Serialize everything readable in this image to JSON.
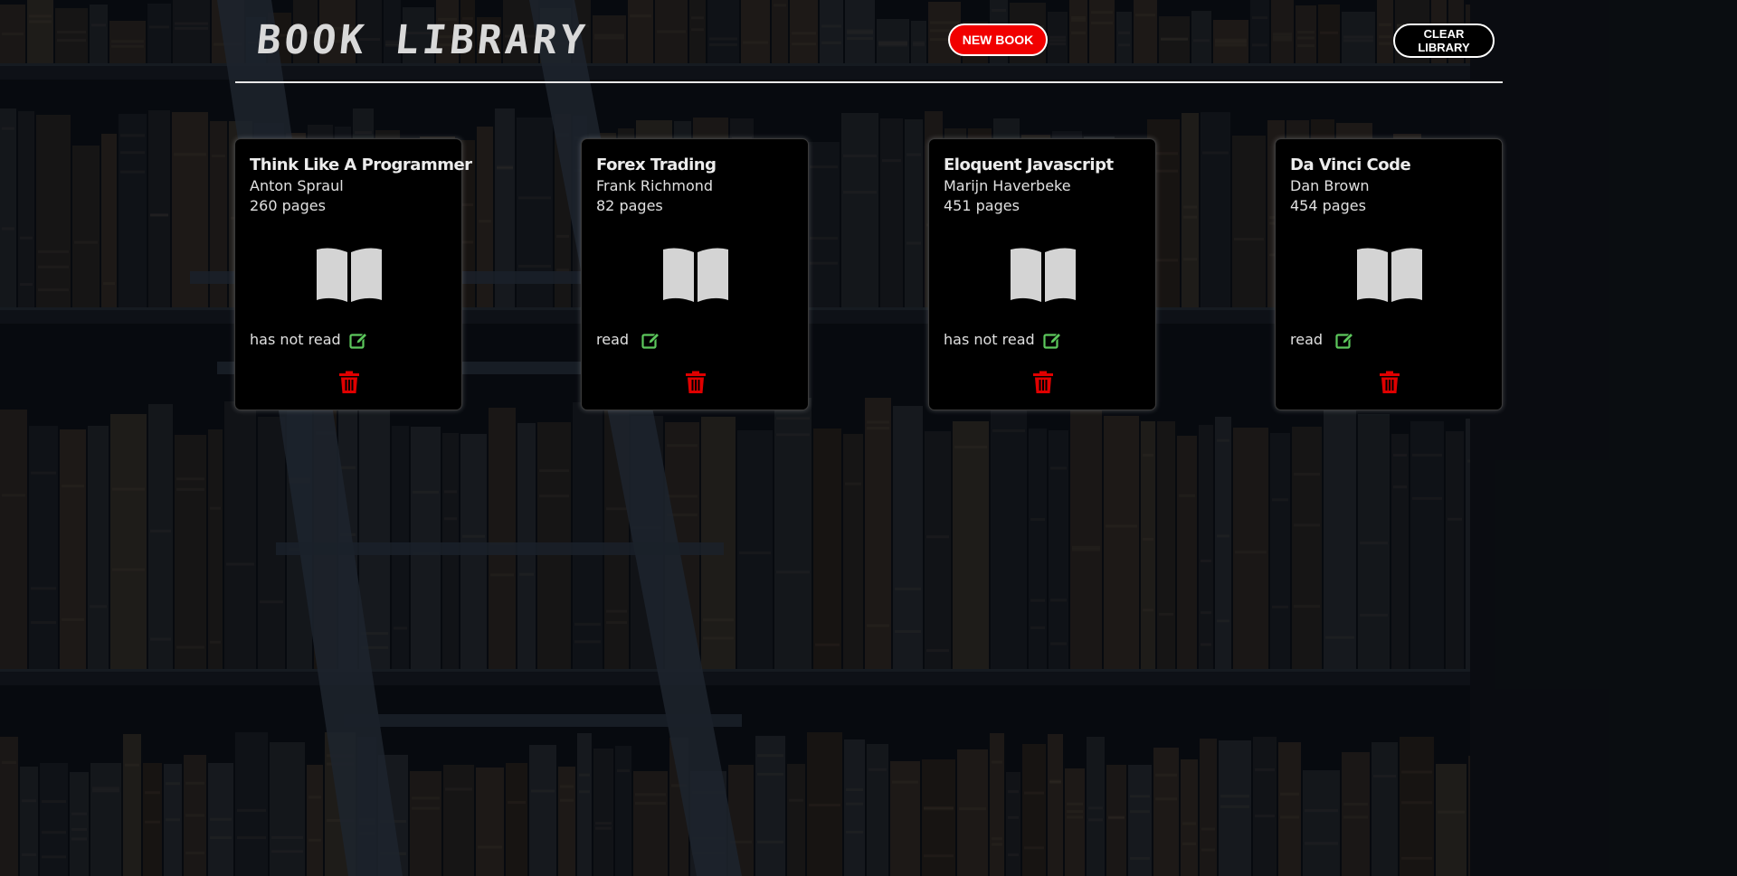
{
  "header": {
    "logo": "BOOK LIBRARY",
    "new_book_label": "NEW BOOK",
    "clear_library_label": "CLEAR\nLIBRARY"
  },
  "colors": {
    "accent_red": "#f10000",
    "edit_green": "#5cc85c",
    "card_bg": "#000000",
    "icon_gray": "#d4d4d4"
  },
  "books": [
    {
      "title": "Think Like A Programmer",
      "author": "Anton Spraul",
      "pages": "260 pages",
      "status": "has not read",
      "icon": "book-open-icon"
    },
    {
      "title": "Forex Trading",
      "author": "Frank Richmond",
      "pages": "82 pages",
      "status": "read",
      "icon": "book-open-icon"
    },
    {
      "title": "Eloquent Javascript",
      "author": "Marijn Haverbeke",
      "pages": "451 pages",
      "status": "has not read",
      "icon": "book-open-icon"
    },
    {
      "title": "Da Vinci Code",
      "author": "Dan Brown",
      "pages": "454 pages",
      "status": "read",
      "icon": "book-open-icon"
    }
  ]
}
